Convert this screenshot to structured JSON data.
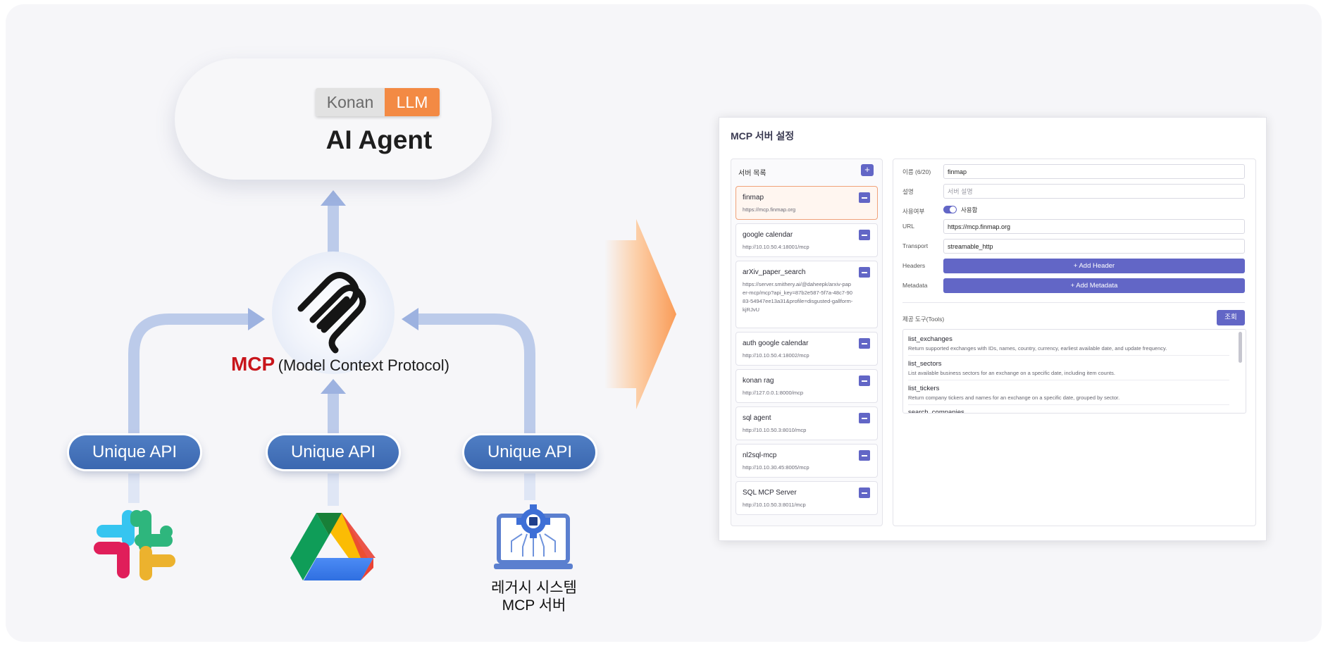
{
  "agent": {
    "brand_left": "Konan",
    "brand_right": "LLM",
    "title": "AI Agent",
    "head_badge": "AI"
  },
  "mcp": {
    "acronym": "MCP",
    "full_name": "(Model Context Protocol)"
  },
  "api_labels": [
    "Unique API",
    "Unique API",
    "Unique API"
  ],
  "sources": {
    "legacy_line1": "레거시 시스템",
    "legacy_line2": "MCP 서버"
  },
  "colors": {
    "accent": "#6266c6",
    "mcp_red": "#c8151b",
    "pill_blue": "#3c68b0",
    "konan_orange": "#f38a44",
    "arrow_blue": "#bccbea"
  },
  "panel": {
    "title": "MCP 서버 설정",
    "list_header": "서버 목록",
    "add_icon": "+",
    "servers": [
      {
        "name": "finmap",
        "url": "https://mcp.finmap.org"
      },
      {
        "name": "google calendar",
        "url": "http://10.10.50.4:18001/mcp"
      },
      {
        "name": "arXiv_paper_search",
        "url": "https://server.smithery.ai/@daheepk/arxiv-paper-mcp/mcp?api_key=87b2e587-5f7a-48c7-9083-54947ee13a31&profile=disgusted-gallform-kjRJvU"
      },
      {
        "name": "auth google calendar",
        "url": "http://10.10.50.4:18002/mcp"
      },
      {
        "name": "konan rag",
        "url": "http://127.0.0.1:8000/mcp"
      },
      {
        "name": "sql agent",
        "url": "http://10.10.50.3:8010/mcp"
      },
      {
        "name": "nl2sql-mcp",
        "url": "http://10.10.30.45:8005/mcp"
      },
      {
        "name": "SQL MCP Server",
        "url": "http://10.10.50.3:8011/mcp"
      }
    ],
    "form": {
      "name_label": "이름 (6/20)",
      "name_value": "finmap",
      "desc_label": "설명",
      "desc_placeholder": "서버 설명",
      "enabled_label": "사용여부",
      "enabled_value": "사용함",
      "url_label": "URL",
      "url_value": "https://mcp.finmap.org",
      "transport_label": "Transport",
      "transport_value": "streamable_http",
      "headers_label": "Headers",
      "add_header": "+ Add Header",
      "metadata_label": "Metadata",
      "add_metadata": "+ Add Metadata"
    },
    "tools_label": "제공 도구(Tools)",
    "query_button": "조회",
    "tools": [
      {
        "name": "list_exchanges",
        "desc": "Return supported exchanges with IDs, names, country, currency, earliest available date, and update frequency."
      },
      {
        "name": "list_sectors",
        "desc": "List available business sectors for an exchange on a specific date, including item counts."
      },
      {
        "name": "list_tickers",
        "desc": "Return company tickers and names for an exchange on a specific date, grouped by sector."
      },
      {
        "name": "search_companies",
        "desc": ""
      }
    ]
  }
}
